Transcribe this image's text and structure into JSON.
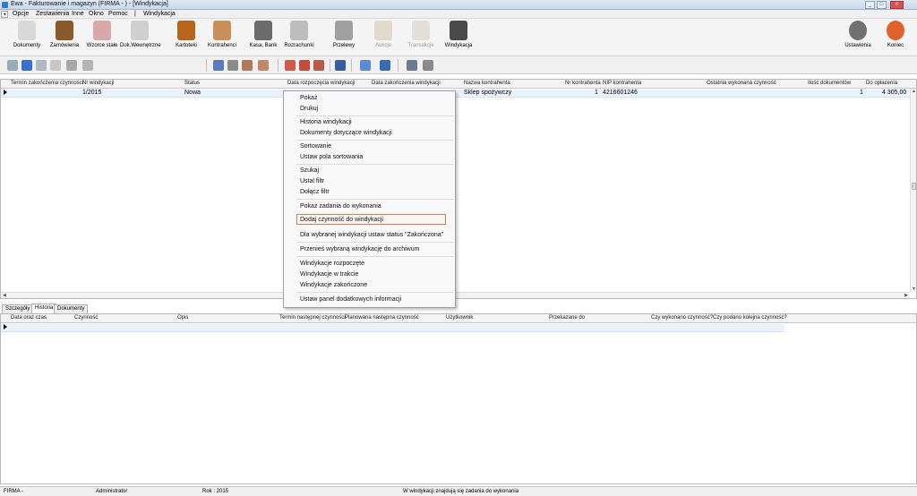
{
  "window": {
    "title": "Ewa - Fakturowanie i magazyn (FIRMA - ) - [Windykacja]",
    "controls": [
      "_",
      "□",
      "x"
    ]
  },
  "menu": {
    "mini_icons": [
      "◂",
      "▸"
    ],
    "items": [
      "Opcje",
      "Zestawienia",
      "Inne",
      "Okno",
      "Pomoc",
      "|",
      "Windykacja"
    ]
  },
  "toolbar": {
    "buttons": [
      {
        "label": "Dokumenty",
        "icon": "documents-icon",
        "color": "#d8d8d8",
        "enabled": true
      },
      {
        "label": "Zamówienia",
        "icon": "orders-icon",
        "color": "#8a5a2c",
        "enabled": true
      },
      {
        "label": "Wzorce stałe",
        "icon": "templates-icon",
        "color": "#d9a9a9",
        "enabled": true
      },
      {
        "label": "Dok.Wewnętrzne",
        "icon": "internal-docs-icon",
        "color": "#cfcfcf",
        "enabled": true
      },
      {
        "label": "Kartoteki",
        "icon": "records-icon",
        "color": "#b5651d",
        "enabled": true
      },
      {
        "label": "Kontrahenci",
        "icon": "contractors-icon",
        "color": "#c8905a",
        "enabled": true
      },
      {
        "label": "Kasa, Bank",
        "icon": "cash-bank-icon",
        "color": "#6b6b6b",
        "enabled": true
      },
      {
        "label": "Rozrachunki",
        "icon": "settlements-icon",
        "color": "#bdbdbd",
        "enabled": true
      },
      {
        "label": "Przelewy",
        "icon": "transfers-icon",
        "color": "#a0a0a0",
        "enabled": true
      },
      {
        "label": "Aukcje",
        "icon": "auctions-icon",
        "color": "#c9b89a",
        "enabled": false
      },
      {
        "label": "Transakcje",
        "icon": "transactions-icon",
        "color": "#d0c4b8",
        "enabled": false
      },
      {
        "label": "Windykacja",
        "icon": "debt-collection-icon",
        "color": "#4a4a4a",
        "enabled": true
      }
    ],
    "right_buttons": [
      {
        "label": "Ustawienia",
        "icon": "gear-icon",
        "color": "#707070"
      },
      {
        "label": "Koniec",
        "icon": "power-icon",
        "color": "#e0622b"
      }
    ],
    "small_icons": [
      {
        "icon": "add-icon",
        "color": "#9ab"
      },
      {
        "icon": "checkmark-icon",
        "color": "#3a6fd0"
      },
      {
        "icon": "edit-icon",
        "color": "#b0b8c4"
      },
      {
        "icon": "copy-icon",
        "color": "#c6c6c6"
      },
      {
        "icon": "print-icon",
        "color": "#a8a8a8"
      },
      {
        "icon": "print-preview-icon",
        "color": "#b4b4b4"
      },
      {
        "icon": "sort-icon",
        "color": "#5a78c0"
      },
      {
        "icon": "search-icon",
        "color": "#8a8a8a"
      },
      {
        "icon": "filter-icon",
        "color": "#b07a5a"
      },
      {
        "icon": "clear-filter-icon",
        "color": "#c08a6a"
      },
      {
        "icon": "document-list-icon",
        "color": "#d05a4a"
      },
      {
        "icon": "document-red-icon",
        "color": "#c84a3a"
      },
      {
        "icon": "document-export-icon",
        "color": "#b85a4a"
      },
      {
        "icon": "pin-icon",
        "color": "#3a5aa0"
      },
      {
        "icon": "panel-icon",
        "color": "#5a8ad0"
      },
      {
        "icon": "phone-icon",
        "color": "#3a6ab0"
      },
      {
        "icon": "calculator-icon",
        "color": "#6a7a90"
      },
      {
        "icon": "notes-icon",
        "color": "#8a8a8a"
      }
    ]
  },
  "top_grid": {
    "columns": [
      "Termin zakończenia czynności",
      "Nr windykacji",
      "Status",
      "Data rozpoczęcia windykacji",
      "Data zakończenia windykacji",
      "Nazwa kontrahenta",
      "Nr kontrahenta",
      "NIP kontrahenta",
      "Ostatnia wykonana czynność",
      "Ilość dokumentów",
      "Do opłacenia"
    ],
    "rows": [
      {
        "nr": "1/2015",
        "status": "Nowa",
        "kontrahent": "Sklep spożywczy",
        "nr_kontrahenta": "1",
        "nip": "4216601246",
        "ilosc": "1",
        "do_oplacenia": "4 305,00"
      }
    ]
  },
  "context_menu": {
    "items": [
      {
        "label": "Pokaż"
      },
      {
        "label": "Drukuj"
      },
      {
        "label": "Historia windykacji"
      },
      {
        "label": "Dokumenty dotyczące windykacji"
      },
      {
        "label": "Sortowanie"
      },
      {
        "label": "Ustaw pola sortowania"
      },
      {
        "label": "Szukaj"
      },
      {
        "label": "Ustal filtr"
      },
      {
        "label": "Dołącz filtr"
      },
      {
        "label": "Pokaż zadania do wykonania"
      },
      {
        "label": "Dodaj czynność do windykacji",
        "highlighted": true
      },
      {
        "label": "Dla wybranej windykacji ustaw status \"Zakończona\""
      },
      {
        "label": "Przenieś wybraną windykację do archiwum"
      },
      {
        "label": "Windykacje rozpoczęte"
      },
      {
        "label": "Windykacje w trakcie"
      },
      {
        "label": "Windykacje zakończone"
      },
      {
        "label": "Ustaw panel dodatkowych informacji"
      }
    ]
  },
  "tabs": [
    {
      "label": "Szczegóły",
      "active": false
    },
    {
      "label": "Historia",
      "active": true
    },
    {
      "label": "Dokumenty",
      "active": false
    }
  ],
  "bottom_grid": {
    "columns": [
      "Data oraz czas",
      "Czynność",
      "Opis",
      "Termin następnej czynności",
      "Planowana następna czynność",
      "Użytkownik",
      "Przekazane do",
      "Czy wykonano czynność?",
      "Czy podano kolejna czynność?"
    ]
  },
  "statusbar": {
    "firm": "FIRMA -",
    "user": "Administrator",
    "year": "Rok : 2015",
    "message": "W windykacji znajdują się zadania do wykonania"
  }
}
